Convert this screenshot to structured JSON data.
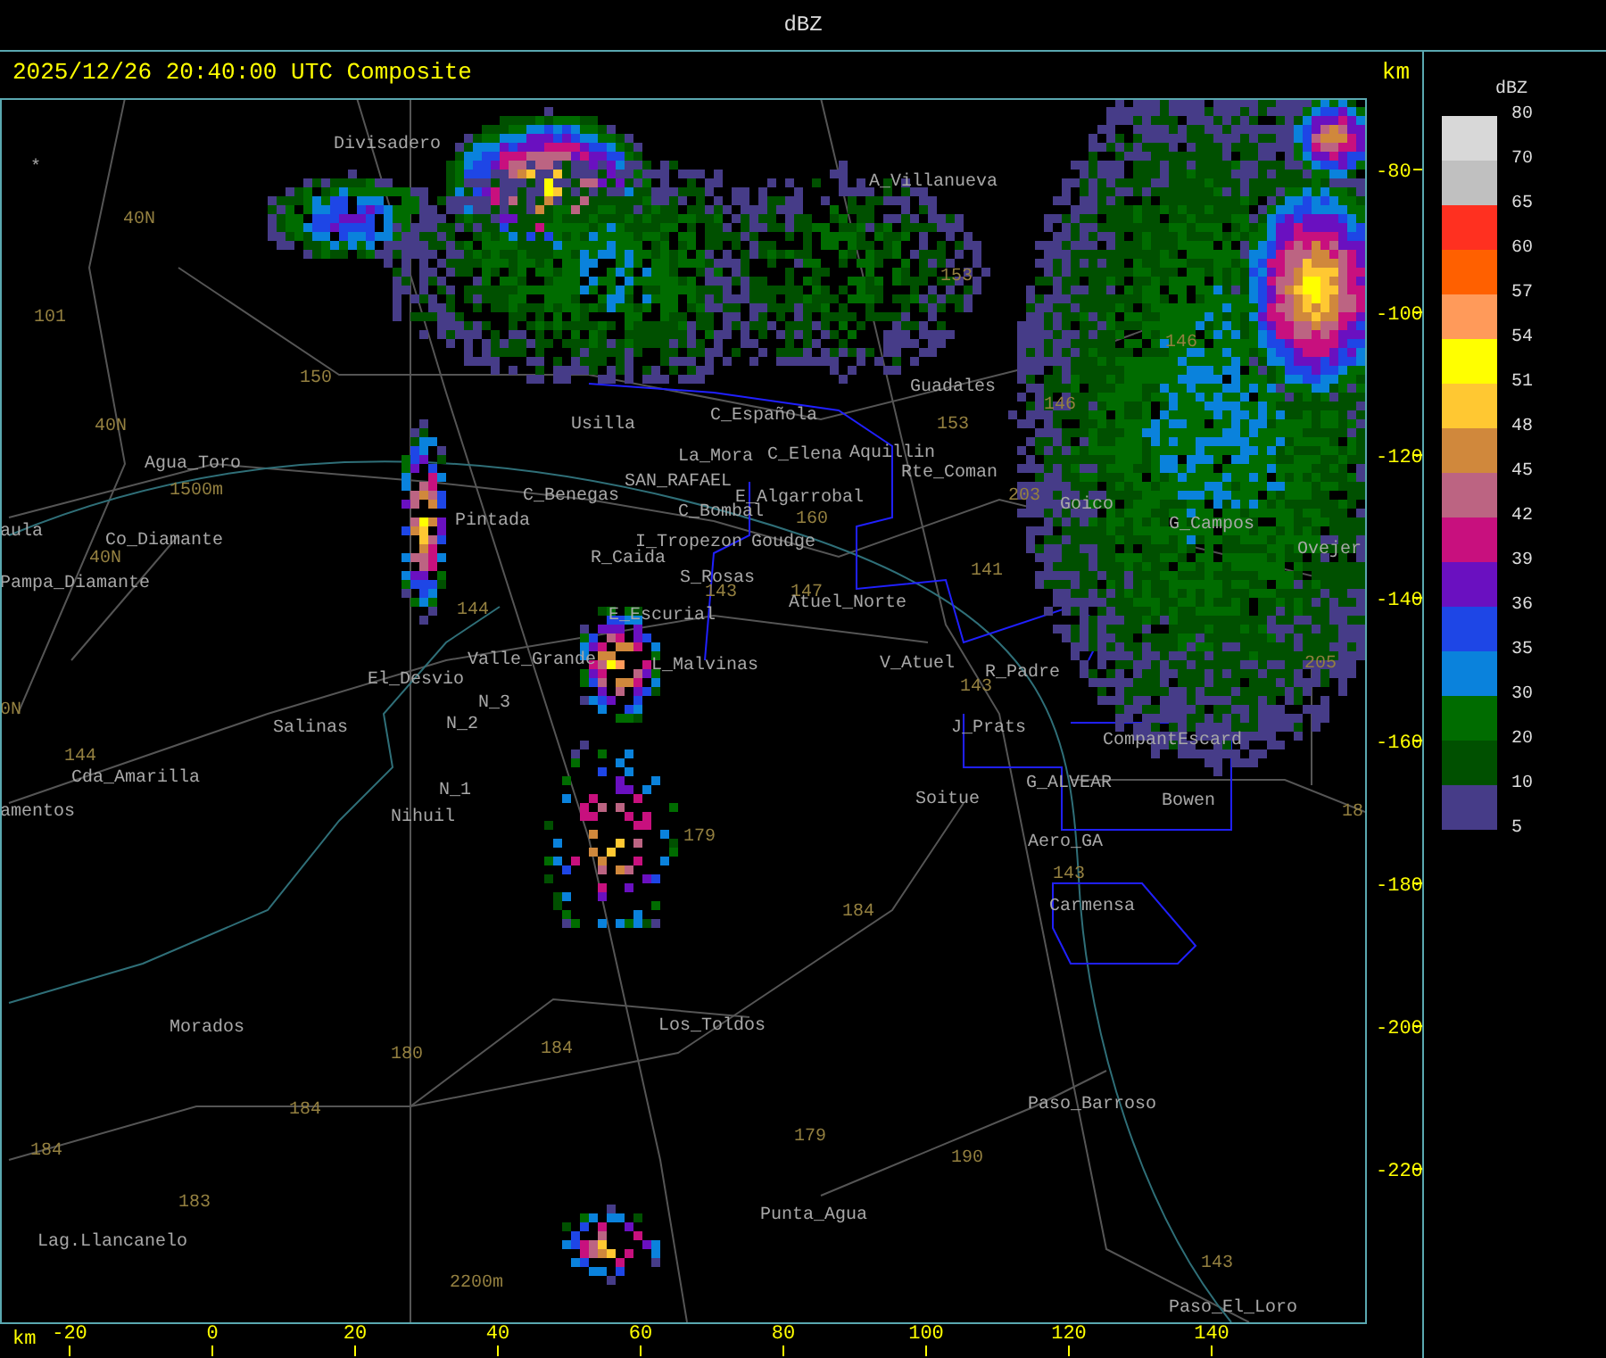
{
  "title": "dBZ",
  "header": {
    "timestamp": "2025/12/26 20:40:00 UTC Composite",
    "unit": "km"
  },
  "map": {
    "places": [
      "Divisadero",
      "*",
      "A_Villanueva",
      "Guadales",
      "C_Española",
      "Usilla",
      "Agua_Toro",
      "La_Mora",
      "C_Elena",
      "Aquillin",
      "Rte_Coman",
      "SAN_RAFAEL",
      "C_Benegas",
      "E_Algarrobal",
      "C_Bombal",
      "Goico",
      "aula",
      "Pintada",
      "G_Campos",
      "Co_Diamante",
      "I_Tropezon",
      "Goudge",
      "Ovejer",
      "R_Caida",
      "Pampa_Diamante",
      "S_Rosas",
      "Atuel_Norte",
      "E_Escurial",
      "El_Desvio",
      "Valle_Grande",
      "L_Malvinas",
      "V_Atuel",
      "R_Padre",
      "N_3",
      "Salinas",
      "N_2",
      "J_Prats",
      "CompantEscard",
      "Cda_Amarilla",
      "N_1",
      "G_ALVEAR",
      "amentos",
      "Nihuil",
      "Soitue",
      "Bowen",
      "Aero_GA",
      "Carmensa",
      "Morados",
      "Los_Toldos",
      "Paso_Barroso",
      "Punta_Agua",
      "Lag.Llancanelo",
      "Paso_El_Loro"
    ],
    "route_numbers": [
      "40N",
      "101",
      "150",
      "40N",
      "1500m",
      "40N",
      "0N",
      "144",
      "144",
      "143",
      "147",
      "141",
      "160",
      "203",
      "153",
      "153",
      "146",
      "146",
      "205",
      "143",
      "179",
      "184",
      "143",
      "180",
      "184",
      "184",
      "184",
      "183",
      "179",
      "190",
      "2200m",
      "143",
      "18"
    ]
  },
  "axes": {
    "y_ticks": [
      "-80",
      "-100",
      "-120",
      "-140",
      "-160",
      "-180",
      "-200",
      "-220"
    ],
    "x_unit": "km",
    "x_ticks": [
      "-20",
      "0",
      "20",
      "40",
      "60",
      "80",
      "100",
      "120",
      "140"
    ]
  },
  "legend": {
    "unit": "dBZ",
    "labels": [
      "80",
      "70",
      "65",
      "60",
      "57",
      "54",
      "51",
      "48",
      "45",
      "42",
      "39",
      "36",
      "35",
      "30",
      "20",
      "10",
      "5"
    ],
    "bands": [
      {
        "color": "#d8d8d8"
      },
      {
        "color": "#c0c0c0"
      },
      {
        "color": "#ff3020"
      },
      {
        "color": "#ff6000"
      },
      {
        "color": "#ff9a5a"
      },
      {
        "color": "#ffff00"
      },
      {
        "color": "#ffc832"
      },
      {
        "color": "#d0883c"
      },
      {
        "color": "#bc6482"
      },
      {
        "color": "#c8107e"
      },
      {
        "color": "#6a10c0"
      },
      {
        "color": "#1e46e6"
      },
      {
        "color": "#0a82dc"
      },
      {
        "color": "#006c00"
      },
      {
        "color": "#005000"
      },
      {
        "color": "#463c88"
      }
    ]
  }
}
